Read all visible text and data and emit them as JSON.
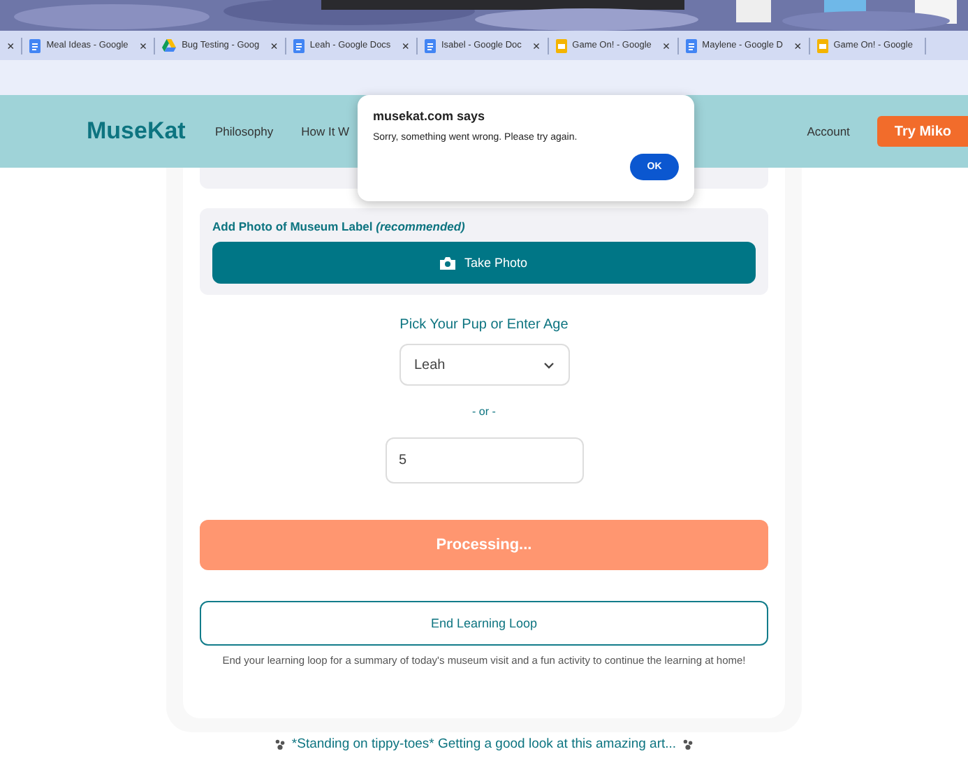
{
  "browser_tabs": [
    {
      "kind": "close-only",
      "close": "×"
    },
    {
      "kind": "docs",
      "title": "Meal Ideas - Google",
      "close": "×"
    },
    {
      "kind": "drive",
      "title": "Bug Testing - Goog",
      "close": "×"
    },
    {
      "kind": "docs",
      "title": "Leah - Google Docs",
      "close": "×"
    },
    {
      "kind": "docs",
      "title": "Isabel - Google Doc",
      "close": "×"
    },
    {
      "kind": "slides",
      "title": "Game On! - Google",
      "close": "×"
    },
    {
      "kind": "docs",
      "title": "Maylene - Google D",
      "close": "×"
    },
    {
      "kind": "slides",
      "title": "Game On! - Google"
    }
  ],
  "nav": {
    "logo": "MuseKat",
    "links": [
      "Philosophy",
      "How It W"
    ],
    "account": "Account",
    "cta": "Try Miko"
  },
  "dialog": {
    "title": "musekat.com says",
    "message": "Sorry, something went wrong. Please try again.",
    "button": "OK"
  },
  "photo_panel": {
    "label": "Add Photo of Museum Label",
    "hint": "(recommended)",
    "button": "Take Photo"
  },
  "pup": {
    "heading": "Pick Your Pup or Enter Age",
    "select_value": "Leah",
    "or": "- or -",
    "age_value": "5"
  },
  "processing_button": {
    "label": "Processing...",
    "disabled": true
  },
  "end_button": "End Learning Loop",
  "end_note": "End your learning loop for a summary of today's museum visit and a fun activity to continue the learning at home!",
  "status": {
    "text": "*Standing on tippy-toes* Getting a good look at this amazing art..."
  }
}
